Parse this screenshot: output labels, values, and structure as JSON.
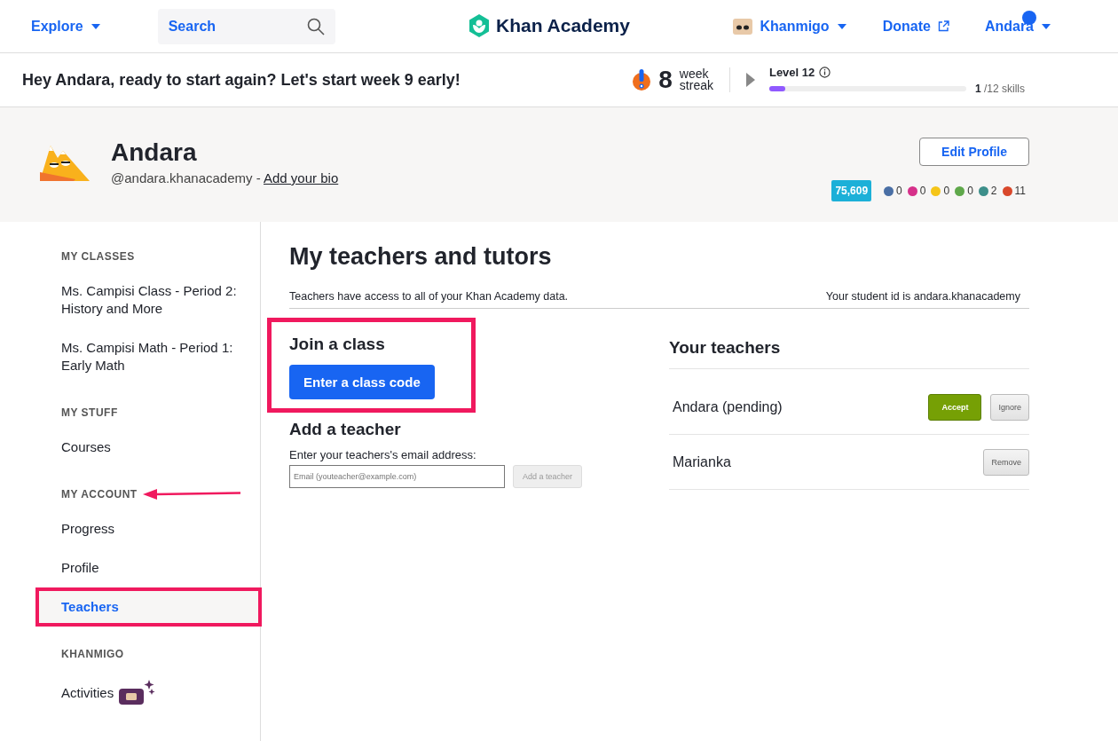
{
  "nav": {
    "explore": "Explore",
    "search_placeholder": "Search",
    "logo": "Khan Academy",
    "khanmigo": "Khanmigo",
    "donate": "Donate",
    "user": "Andara",
    "notification": true
  },
  "greeting": {
    "text": "Hey Andara, ready to start again? Let's start week 9 early!",
    "streak_count": "8",
    "streak_label_1": "week",
    "streak_label_2": "streak",
    "level_title": "Level 12",
    "level": 0.08,
    "skills_done": "1",
    "skills_total": "/12 skills"
  },
  "profile": {
    "name": "Andara",
    "username": "@andara.khanacademy -",
    "bio_link": "Add your bio",
    "edit_button": "Edit Profile",
    "points": "75,609",
    "badges": [
      {
        "color": "#4a6fa5",
        "count": "0"
      },
      {
        "color": "#d6318a",
        "count": "0"
      },
      {
        "color": "#f5c518",
        "count": "0"
      },
      {
        "color": "#5fa84a",
        "count": "0"
      },
      {
        "color": "#3d8f8a",
        "count": "2"
      },
      {
        "color": "#d9482b",
        "count": "11"
      }
    ]
  },
  "sidebar": {
    "sections": [
      {
        "heading": "MY CLASSES",
        "kind": "plain",
        "items": [
          {
            "label": "Ms. Campisi Class - Period 2: History and More",
            "selected": false,
            "kind": "plain"
          },
          {
            "label": "Ms. Campisi Math - Period 1: Early Math",
            "selected": false,
            "kind": "plain"
          }
        ]
      },
      {
        "heading": "MY STUFF",
        "kind": "plain",
        "items": [
          {
            "label": "Courses",
            "selected": false,
            "kind": "plain"
          }
        ]
      },
      {
        "heading": "MY ACCOUNT",
        "kind": "pointed",
        "items": [
          {
            "label": "Progress",
            "selected": false,
            "kind": "plain"
          },
          {
            "label": "Profile",
            "selected": false,
            "kind": "plain"
          },
          {
            "label": "Teachers",
            "selected": true,
            "kind": "framed"
          }
        ]
      },
      {
        "heading": "KHANMIGO",
        "kind": "plain",
        "items": [
          {
            "label": "Activities",
            "selected": false,
            "kind": "khanmigo"
          }
        ]
      }
    ]
  },
  "main": {
    "title": "My teachers and tutors",
    "note": "Teachers have access to all of your Khan Academy data.",
    "student_id": "Your student id is andara.khanacademy",
    "join": {
      "heading": "Join a class",
      "button": "Enter a class code",
      "highlighted": true
    },
    "add": {
      "heading": "Add a teacher",
      "label": "Enter your teachers's email address:",
      "placeholder": "Email (youteacher@example.com)",
      "button": "Add a teacher",
      "button_disabled": true
    },
    "teachers": {
      "heading": "Your teachers",
      "rows": [
        {
          "name": "Andara (pending)",
          "buttons": [
            {
              "label": "Accept",
              "kind": "accept"
            },
            {
              "label": "Ignore",
              "kind": "ignore"
            }
          ]
        },
        {
          "name": "Marianka",
          "buttons": [
            {
              "label": "Remove",
              "kind": "remove"
            }
          ]
        }
      ]
    }
  }
}
